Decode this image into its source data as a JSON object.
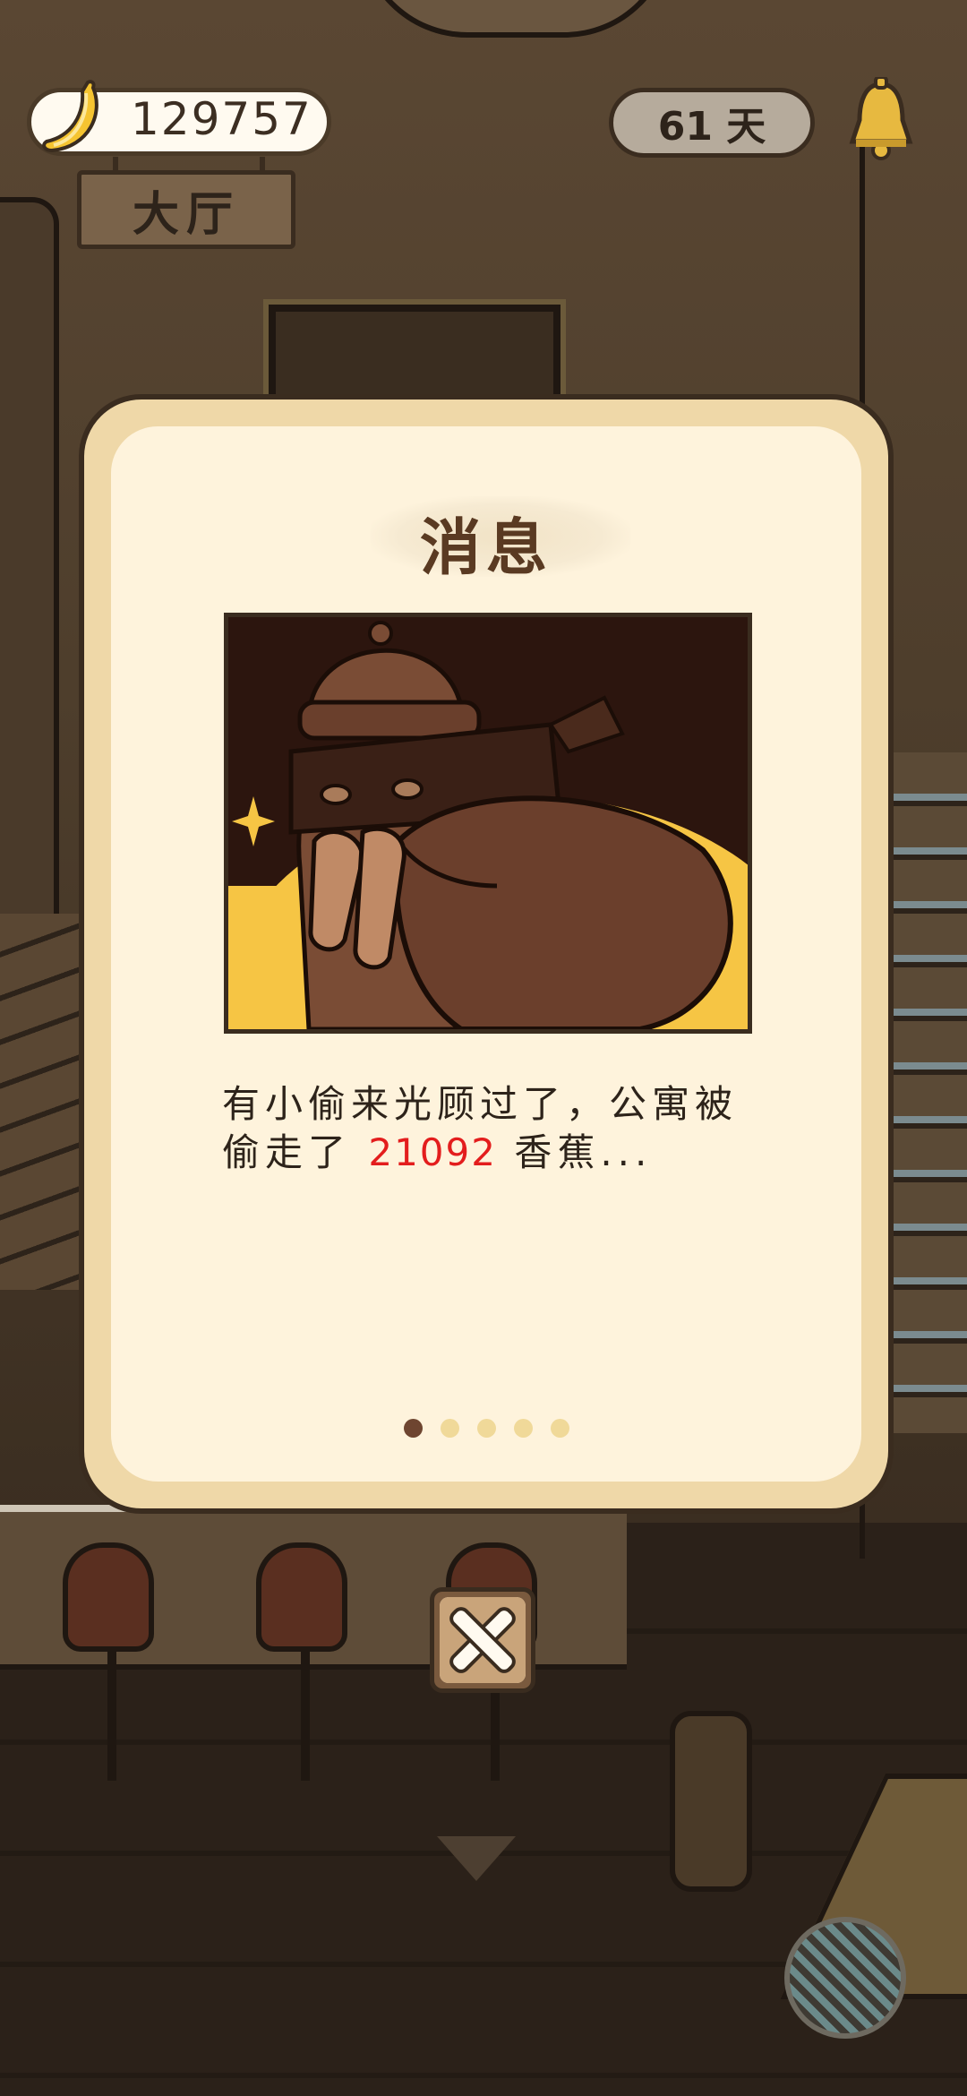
{
  "hud": {
    "banana_count": "129757",
    "room_sign": "大厅",
    "days": "61 天",
    "icons": [
      "banana-icon",
      "bell-icon"
    ]
  },
  "modal": {
    "title": "消息",
    "message_prefix": "有小偷来光顾过了，公寓被偷走了 ",
    "message_amount": "21092",
    "message_suffix": " 香蕉...",
    "page_count": 5,
    "active_page": 1,
    "illustration": "thief-with-sack-illustration"
  },
  "controls": {
    "close_icon": "close-icon",
    "scroll_down_icon": "chevron-down-icon",
    "yarn_icon": "yarn-ball-icon"
  },
  "colors": {
    "accent_red": "#e31d1d",
    "modal_border": "#efd8a8",
    "modal_body": "#fef3dc",
    "dot_active": "#6e4530",
    "dot_inactive": "#f0d999"
  }
}
